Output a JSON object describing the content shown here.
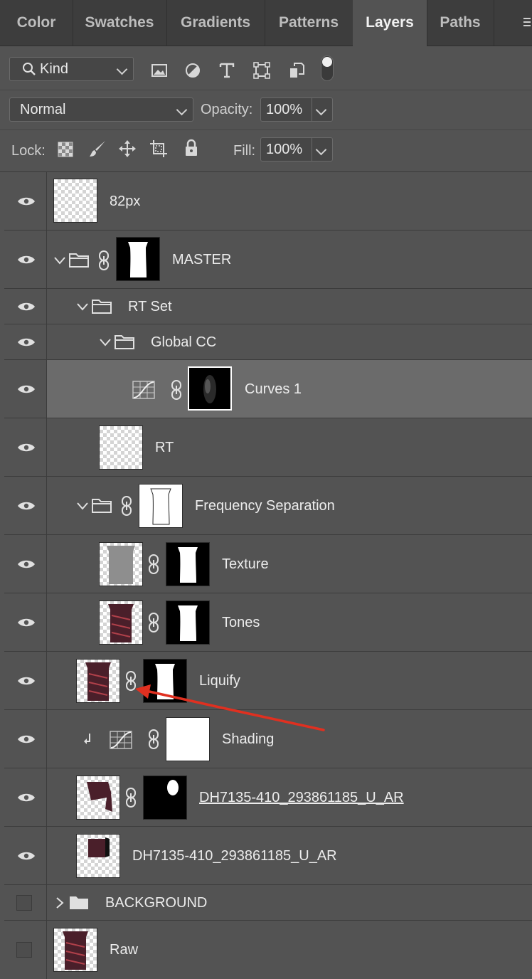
{
  "tabs": [
    "Color",
    "Swatches",
    "Gradients",
    "Patterns",
    "Layers",
    "Paths"
  ],
  "filter": {
    "kind_label": "Kind"
  },
  "blend": {
    "mode": "Normal",
    "opacity_label": "Opacity:",
    "opacity": "100%"
  },
  "lock": {
    "label": "Lock:",
    "fill_label": "Fill:",
    "fill": "100%"
  },
  "layers": [
    {
      "name": "82px"
    },
    {
      "name": "MASTER"
    },
    {
      "name": "RT Set"
    },
    {
      "name": "Global CC"
    },
    {
      "name": "Curves 1"
    },
    {
      "name": "RT"
    },
    {
      "name": "Frequency Separation"
    },
    {
      "name": "Texture"
    },
    {
      "name": "Tones"
    },
    {
      "name": "Liquify"
    },
    {
      "name": "Shading"
    },
    {
      "name": "DH7135-410_293861185_U_AR"
    },
    {
      "name": "DH7135-410_293861185_U_AR"
    },
    {
      "name": "BACKGROUND"
    },
    {
      "name": "Raw"
    }
  ],
  "colors": {
    "panel": "#535353",
    "selected": "#6b6b6b",
    "annotation_arrow": "#e03020"
  },
  "icons": [
    "search-icon",
    "image-filter-icon",
    "adjustment-filter-icon",
    "type-filter-icon",
    "shape-filter-icon",
    "smart-object-filter-icon",
    "filter-toggle-icon",
    "lock-transparent-icon",
    "lock-paint-icon",
    "lock-move-icon",
    "lock-artboard-icon",
    "lock-all-icon",
    "eye-icon",
    "folder-icon",
    "link-icon",
    "curves-icon",
    "clip-arrow-icon",
    "panel-menu-icon"
  ]
}
